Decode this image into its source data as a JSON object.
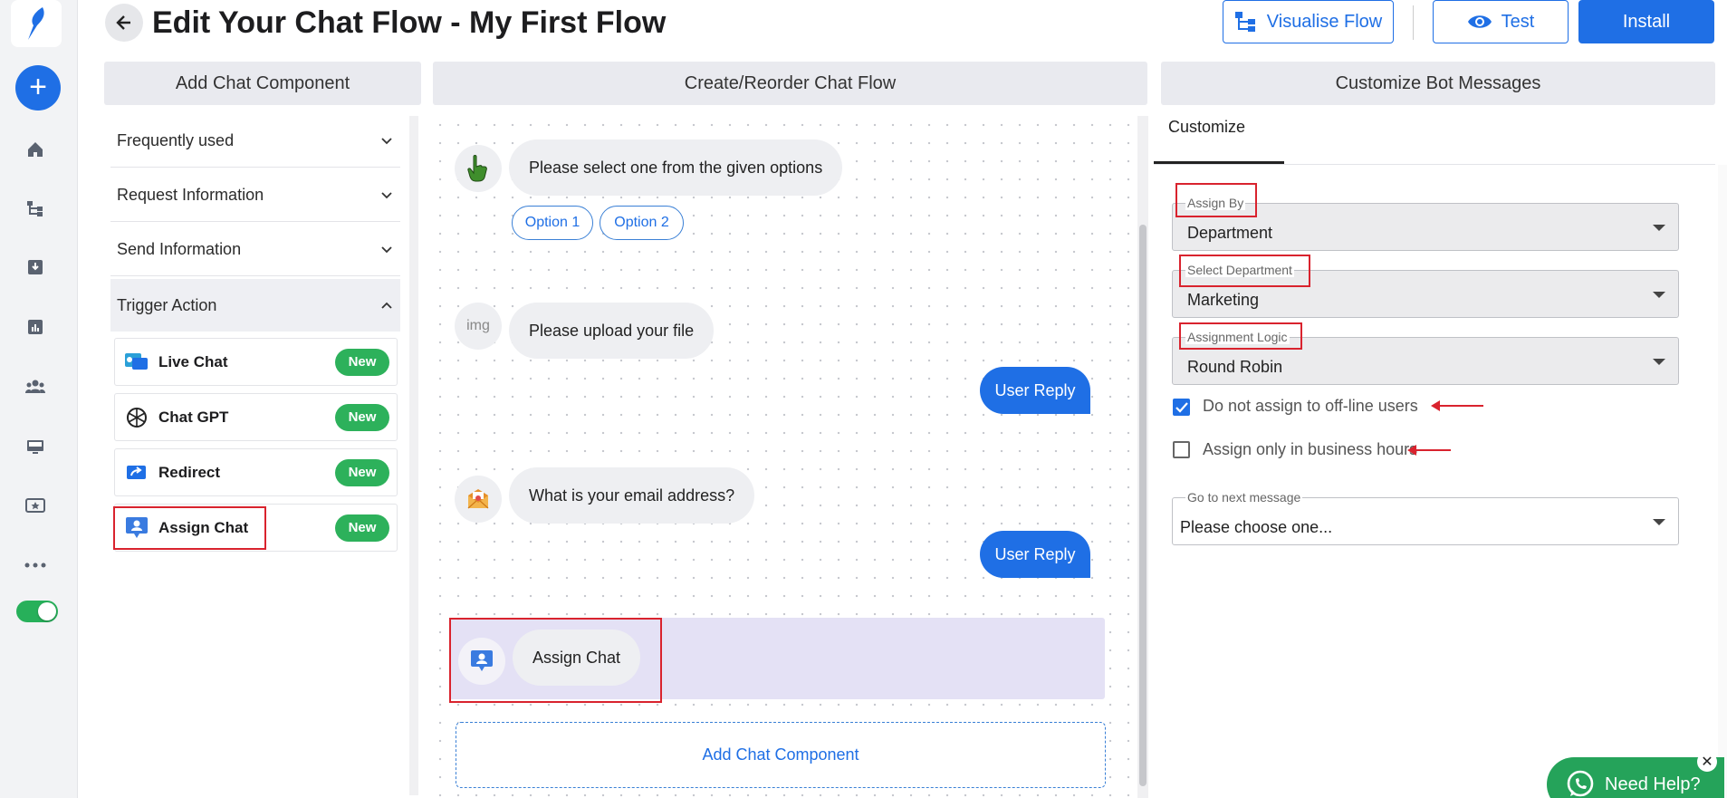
{
  "header": {
    "title": "Edit Your Chat Flow - My First Flow",
    "visualise_label": "Visualise Flow",
    "test_label": "Test",
    "install_label": "Install"
  },
  "rail": {
    "icons": [
      "plus-icon",
      "home-icon",
      "flow-icon",
      "inbox-icon",
      "analytics-icon",
      "team-icon",
      "monitor-icon",
      "ticket-icon",
      "more-icon"
    ],
    "toggle_on": true
  },
  "columns": {
    "left": "Add Chat Component",
    "center": "Create/Reorder Chat Flow",
    "right": "Customize Bot Messages"
  },
  "left_panel": {
    "sections": [
      "Frequently used",
      "Request Information",
      "Send Information",
      "Trigger Action"
    ],
    "components": [
      {
        "label": "Live Chat",
        "badge": "New"
      },
      {
        "label": "Chat GPT",
        "badge": "New"
      },
      {
        "label": "Redirect",
        "badge": "New"
      },
      {
        "label": "Assign Chat",
        "badge": "New"
      }
    ]
  },
  "flow": {
    "msg1": "Please select one from the given options",
    "options": [
      "Option 1",
      "Option 2"
    ],
    "img_alt": "img",
    "msg2": "Please upload your file",
    "user_reply": "User Reply",
    "msg3": "What is your email address?",
    "assign_msg": "Assign Chat",
    "add_component": "Add Chat Component"
  },
  "right_panel": {
    "tab": "Customize",
    "assign_by": {
      "label": "Assign By",
      "value": "Department"
    },
    "select_department": {
      "label": "Select Department",
      "value": "Marketing"
    },
    "assignment_logic": {
      "label": "Assignment Logic",
      "value": "Round Robin"
    },
    "chk_offline": {
      "label": "Do not assign to off-line users",
      "checked": true
    },
    "chk_business": {
      "label": "Assign only in business hours",
      "checked": false
    },
    "next_message": {
      "label": "Go to next message",
      "value": "Please choose one..."
    }
  },
  "help": {
    "label": "Need Help?"
  },
  "colors": {
    "primary": "#1f6fe5",
    "success": "#2db15b",
    "annotation": "#d9232e",
    "assign_bg": "#e4e1f5"
  }
}
